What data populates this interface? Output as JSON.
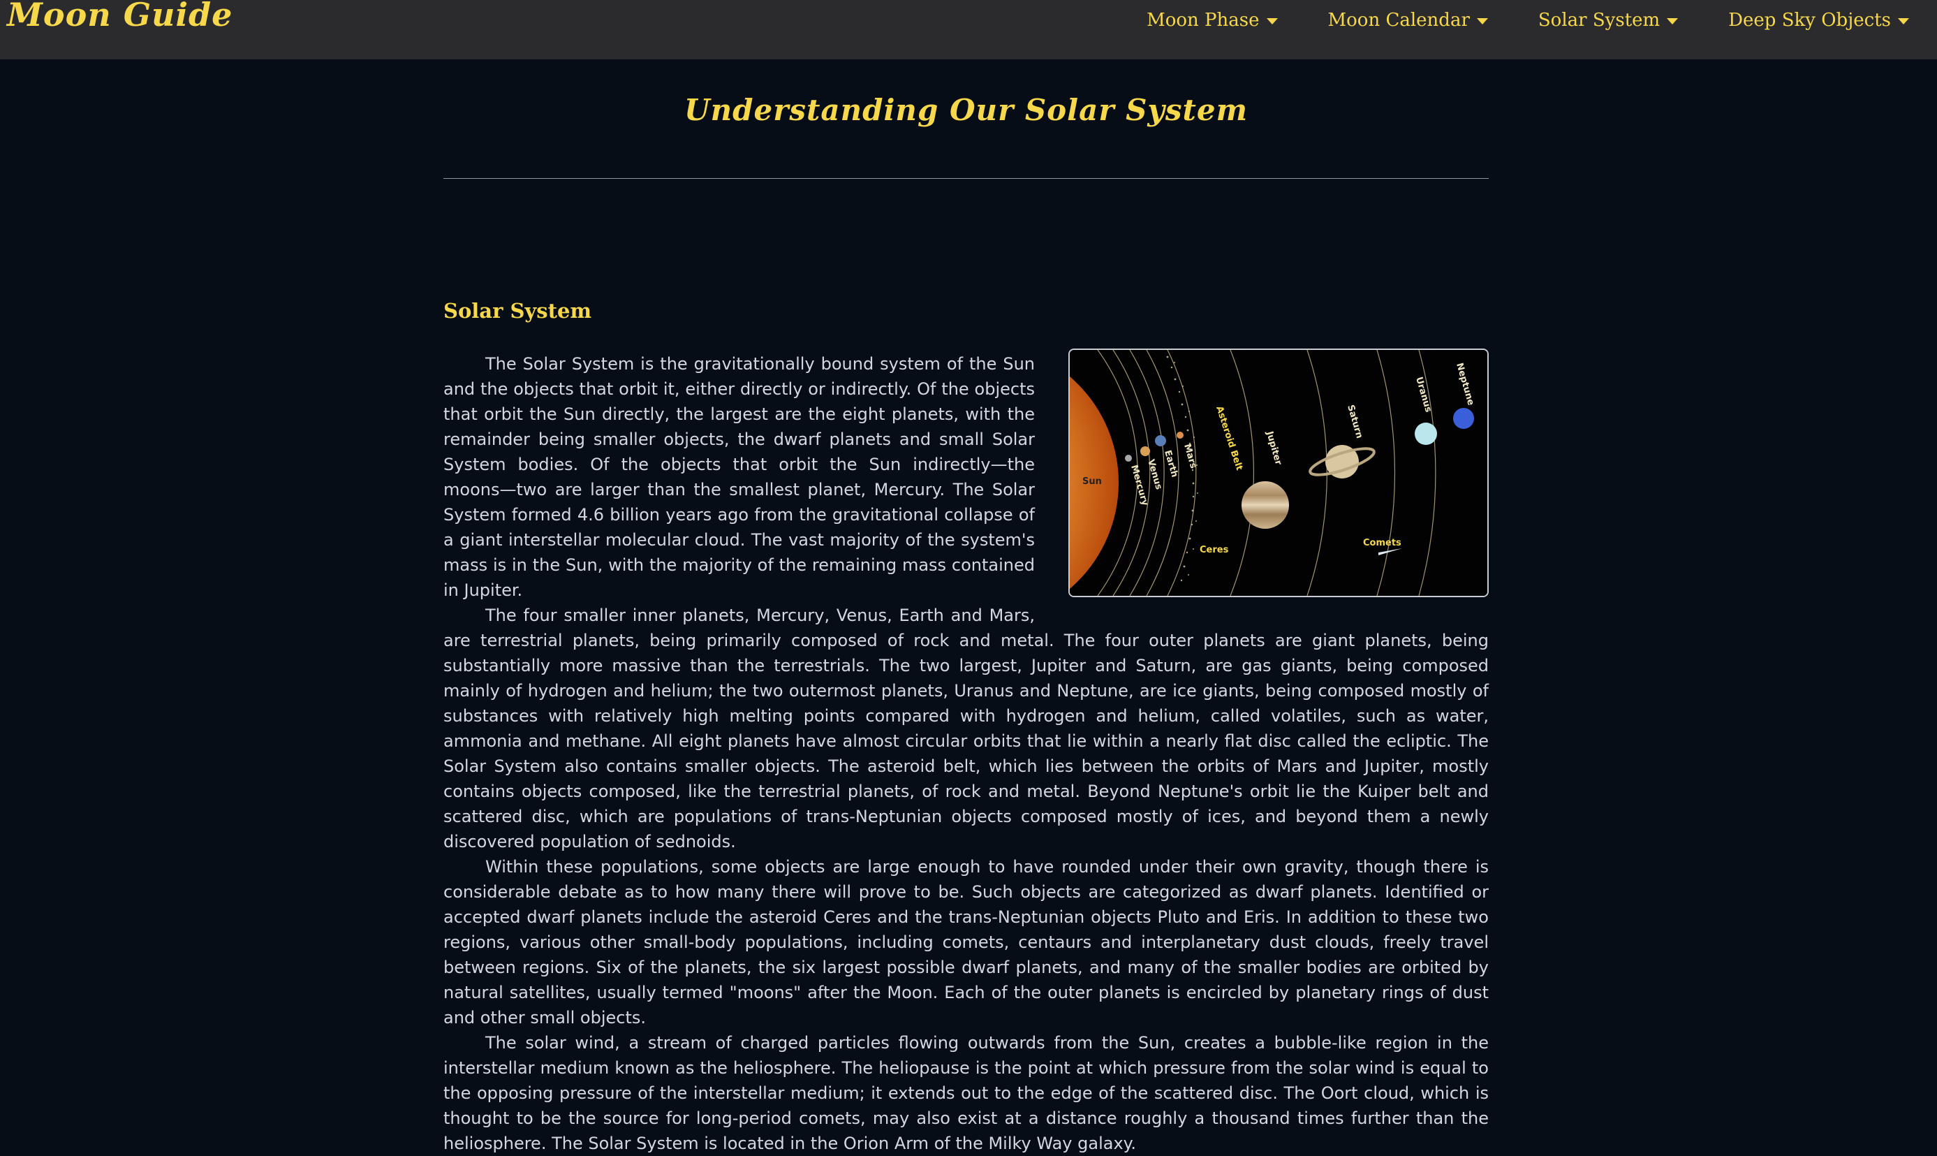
{
  "brand": "Moon Guide",
  "nav": {
    "items": [
      {
        "label": "Moon Phase"
      },
      {
        "label": "Moon Calendar"
      },
      {
        "label": "Solar System"
      },
      {
        "label": "Deep Sky Objects"
      }
    ]
  },
  "page_title": "Understanding Our Solar System",
  "section_title": "Solar System",
  "figure": {
    "labels": {
      "sun": "Sun",
      "mercury": "Mercury",
      "venus": "Venus",
      "earth": "Earth",
      "mars": "Mars",
      "asteroid_belt": "Asteroid Belt",
      "ceres": "Ceres",
      "jupiter": "Jupiter",
      "saturn": "Saturn",
      "uranus": "Uranus",
      "neptune": "Neptune",
      "comets": "Comets"
    }
  },
  "paragraphs": [
    "The Solar System is the gravitationally bound system of the Sun and the objects that orbit it, either directly or indirectly. Of the objects that orbit the Sun directly, the largest are the eight planets, with the remainder being smaller objects, the dwarf planets and small Solar System bodies. Of the objects that orbit the Sun indirectly—the moons—two are larger than the smallest planet, Mercury. The Solar System formed 4.6 billion years ago from the gravitational collapse of a giant interstellar molecular cloud. The vast majority of the system's mass is in the Sun, with the majority of the remaining mass contained in Jupiter.",
    "The four smaller inner planets, Mercury, Venus, Earth and Mars, are terrestrial planets, being primarily composed of rock and metal. The four outer planets are giant planets, being substantially more massive than the terrestrials. The two largest, Jupiter and Saturn, are gas giants, being composed mainly of hydrogen and helium; the two outermost planets, Uranus and Neptune, are ice giants, being composed mostly of substances with relatively high melting points compared with hydrogen and helium, called volatiles, such as water, ammonia and methane. All eight planets have almost circular orbits that lie within a nearly flat disc called the ecliptic. The Solar System also contains smaller objects. The asteroid belt, which lies between the orbits of Mars and Jupiter, mostly contains objects composed, like the terrestrial planets, of rock and metal. Beyond Neptune's orbit lie the Kuiper belt and scattered disc, which are populations of trans-Neptunian objects composed mostly of ices, and beyond them a newly discovered population of sednoids.",
    "Within these populations, some objects are large enough to have rounded under their own gravity, though there is considerable debate as to how many there will prove to be. Such objects are categorized as dwarf planets. Identified or accepted dwarf planets include the asteroid Ceres and the trans-Neptunian objects Pluto and Eris. In addition to these two regions, various other small-body populations, including comets, centaurs and interplanetary dust clouds, freely travel between regions. Six of the planets, the six largest possible dwarf planets, and many of the smaller bodies are orbited by natural satellites, usually termed \"moons\" after the Moon. Each of the outer planets is encircled by planetary rings of dust and other small objects.",
    "The solar wind, a stream of charged particles flowing outwards from the Sun, creates a bubble-like region in the interstellar medium known as the heliosphere. The heliopause is the point at which pressure from the solar wind is equal to the opposing pressure of the interstellar medium; it extends out to the edge of the scattered disc. The Oort cloud, which is thought to be the source for long-period comets, may also exist at a distance roughly a thousand times further than the heliosphere. The Solar System is located in the Orion Arm of the Milky Way galaxy."
  ]
}
